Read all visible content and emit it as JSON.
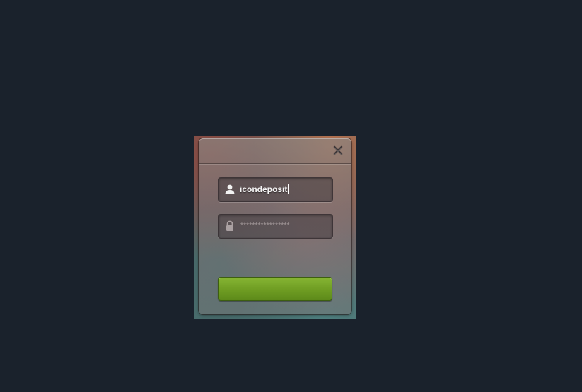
{
  "login_card": {
    "close_icon": "close-icon",
    "username": {
      "icon": "user-icon",
      "value": "icondeposit"
    },
    "password": {
      "icon": "lock-icon",
      "masked_value": "*****************"
    },
    "submit": {
      "label": "",
      "color": "#75a327"
    }
  }
}
